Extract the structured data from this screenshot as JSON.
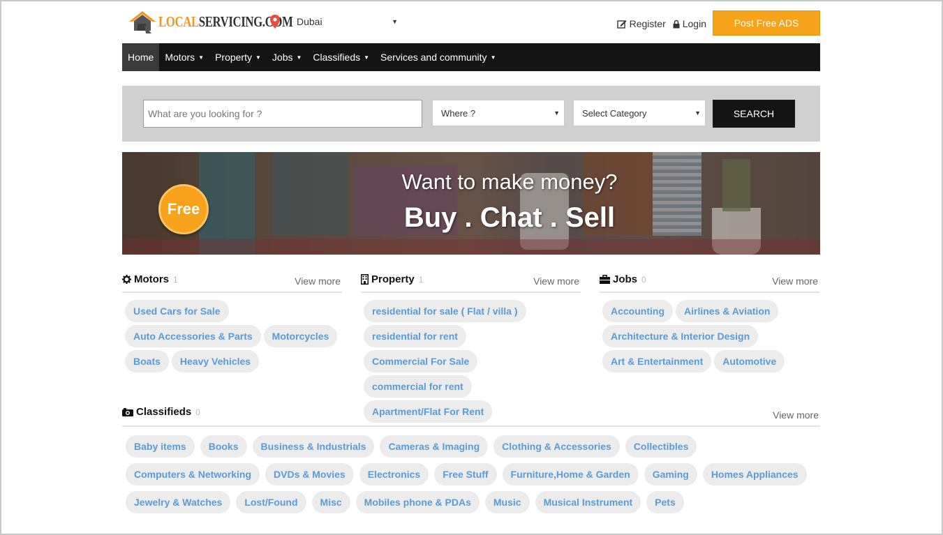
{
  "header": {
    "logo": {
      "part1": "LOCAL",
      "part2": "SERVICING.COM"
    },
    "city": "Dubai",
    "register": "Register",
    "login": "Login",
    "post_button": "Post Free ADS"
  },
  "nav": {
    "items": [
      {
        "label": "Home",
        "active": true,
        "dropdown": false
      },
      {
        "label": "Motors",
        "dropdown": true
      },
      {
        "label": "Property",
        "dropdown": true
      },
      {
        "label": "Jobs",
        "dropdown": true
      },
      {
        "label": "Classifieds",
        "dropdown": true
      },
      {
        "label": "Services and community",
        "dropdown": true
      }
    ]
  },
  "search": {
    "placeholder": "What are you looking for ?",
    "where": "Where ?",
    "category": "Select Category",
    "button": "SEARCH"
  },
  "banner": {
    "badge": "Free",
    "line1": "Want to make money?",
    "line2": "Buy . Chat . Sell"
  },
  "sections": {
    "motors": {
      "title": "Motors",
      "count": "1",
      "view_more": "View more",
      "tags": [
        "Used Cars for Sale",
        "Auto Accessories & Parts",
        "Motorcycles",
        "Boats",
        "Heavy Vehicles"
      ]
    },
    "property": {
      "title": "Property",
      "count": "1",
      "view_more": "View more",
      "tags": [
        "residential for sale ( Flat / villa )",
        "residential for rent",
        "Commercial For Sale",
        "commercial for rent",
        "Apartment/Flat For Rent"
      ]
    },
    "jobs": {
      "title": "Jobs",
      "count": "0",
      "view_more": "View more",
      "tags": [
        "Accounting",
        "Airlines & Aviation",
        "Architecture & Interior Design",
        "Art & Entertainment",
        "Automotive"
      ]
    },
    "classifieds": {
      "title": "Classifieds",
      "count": "0",
      "view_more": "View more",
      "tags": [
        "Baby items",
        "Books",
        "Business & Industrials",
        "Cameras & Imaging",
        "Clothing & Accessories",
        "Collectibles",
        "Computers & Networking",
        "DVDs & Movies",
        "Electronics",
        "Free Stuff",
        "Furniture,Home & Garden",
        "Gaming",
        "Homes Appliances",
        "Jewelry & Watches",
        "Lost/Found",
        "Misc",
        "Mobiles phone & PDAs",
        "Music",
        "Musical Instrument",
        "Pets"
      ]
    }
  },
  "colors": {
    "accent": "#f7a21b",
    "nav_bg": "#141414",
    "tag_text": "#5b9bd5",
    "tag_bg": "#ececec"
  }
}
